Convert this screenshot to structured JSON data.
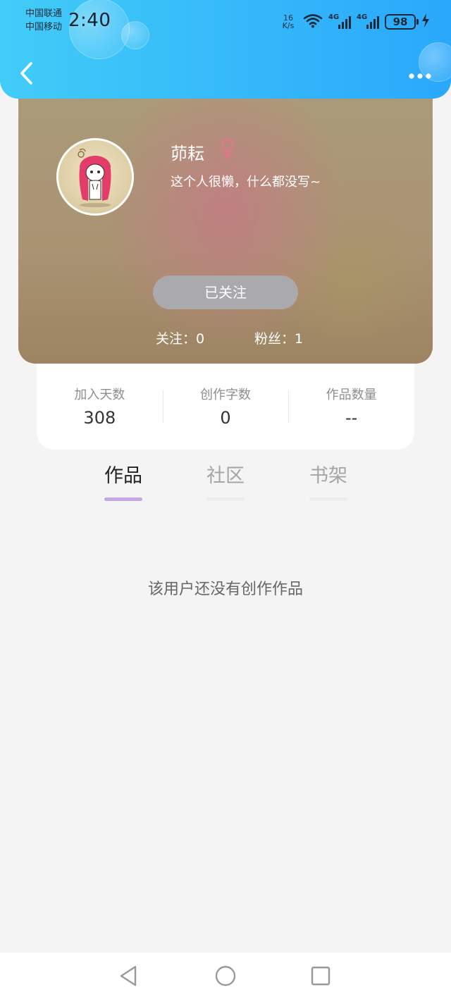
{
  "status_bar": {
    "carrier_1": "中国联通",
    "carrier_2": "中国移动",
    "time": "2:40",
    "net_speed_value": "16",
    "net_speed_unit": "K/s",
    "signal_1_label": "4G",
    "signal_2_label": "4G",
    "battery_level": "98",
    "icons": [
      "wifi-icon",
      "signal-icon",
      "battery-icon",
      "charging-icon"
    ]
  },
  "nav": {
    "back_icon": "chevron-left-icon",
    "more_icon": "more-dots-icon"
  },
  "profile": {
    "name": "茆耘",
    "gender_icon": "female-icon",
    "gender_color": "#e8738f",
    "bio": "这个人很懒，什么都没写~",
    "follow_button_label": "已关注",
    "following_text": "关注：0",
    "followers_text": "粉丝：1"
  },
  "stats": [
    {
      "label": "加入天数",
      "value": "308"
    },
    {
      "label": "创作字数",
      "value": "0"
    },
    {
      "label": "作品数量",
      "value": "--"
    }
  ],
  "tabs": [
    {
      "label": "作品",
      "active": true
    },
    {
      "label": "社区",
      "active": false
    },
    {
      "label": "书架",
      "active": false
    }
  ],
  "empty_message": "该用户还没有创作作品",
  "colors": {
    "header_start": "#42ccf8",
    "header_end": "#2aa8fb",
    "tab_indicator": "#c5a7e6",
    "background": "#f4f4f4"
  },
  "system_nav": {
    "icons": [
      "back-triangle-icon",
      "home-circle-icon",
      "recents-square-icon"
    ]
  }
}
